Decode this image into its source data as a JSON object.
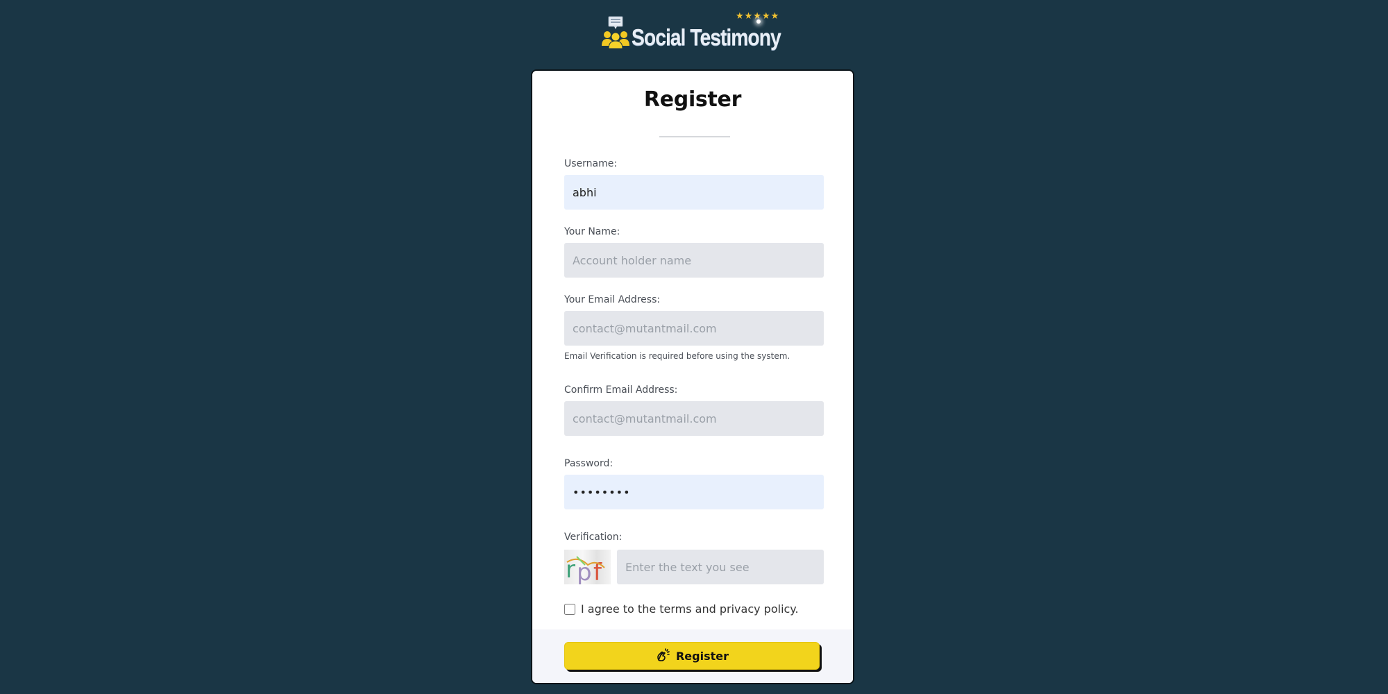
{
  "brand": {
    "name": "Social Testimony",
    "rating_stars": 5,
    "stars_glyph": "★★★★★",
    "accent_color": "#f2c230",
    "background_color": "#1a3645"
  },
  "form": {
    "title": "Register",
    "fields": {
      "username": {
        "label": "Username:",
        "value": "abhi",
        "placeholder": ""
      },
      "name": {
        "label": "Your Name:",
        "value": "",
        "placeholder": "Account holder name"
      },
      "email": {
        "label": "Your Email Address:",
        "value": "",
        "placeholder": "contact@mutantmail.com",
        "helper": "Email Verification is required before using the system."
      },
      "confirm_email": {
        "label": "Confirm Email Address:",
        "value": "",
        "placeholder": "contact@mutantmail.com"
      },
      "password": {
        "label": "Password:",
        "value": "••••••••",
        "placeholder": ""
      },
      "verification": {
        "label": "Verification:",
        "captcha_text": "rpf",
        "value": "",
        "placeholder": "Enter the text you see"
      }
    },
    "agree": {
      "label": "I agree to the terms and privacy policy.",
      "checked": false
    },
    "submit": {
      "label": "Register",
      "icon": "snap-hand-icon",
      "color": "#f2d41c"
    }
  }
}
